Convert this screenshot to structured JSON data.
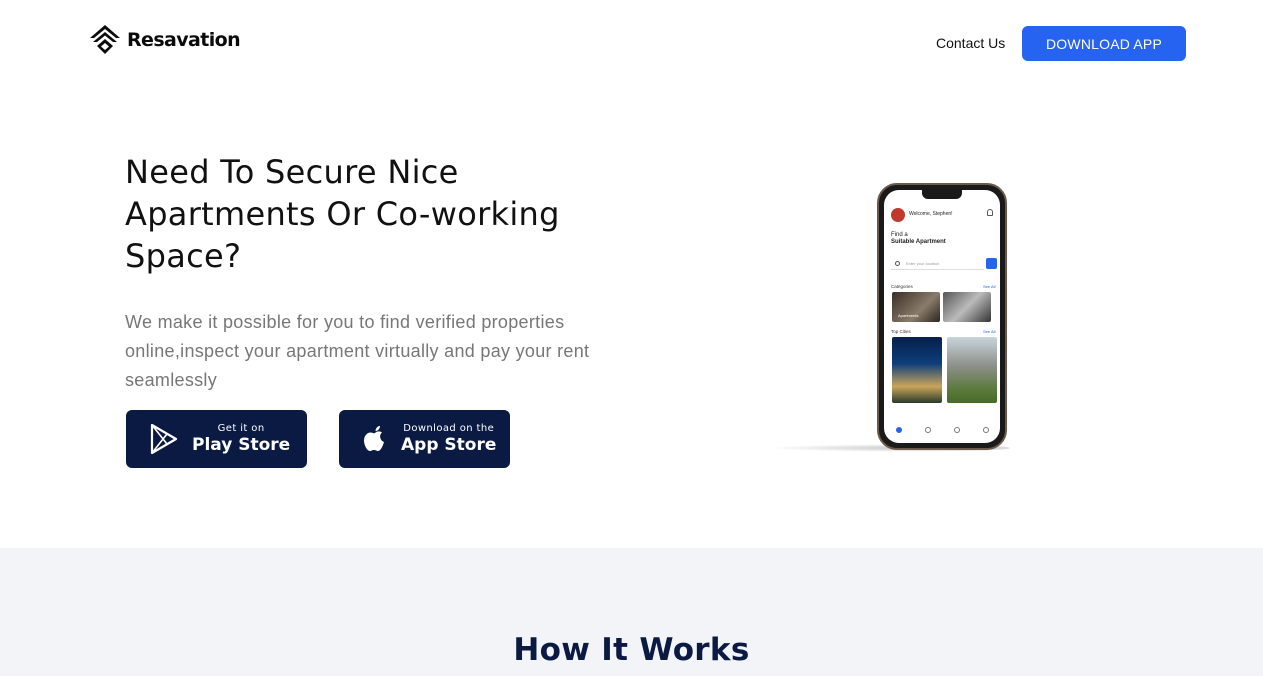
{
  "header": {
    "brand": "Resavation",
    "contact_label": "Contact Us",
    "download_label": "DOWNLOAD APP"
  },
  "hero": {
    "title": "Need To Secure Nice Apartments Or Co-working Space?",
    "subtitle": "We make it possible for you to find verified properties online,inspect your apartment virtually and pay your rent seamlessly",
    "play_store": {
      "small": "Get it on",
      "big": "Play Store"
    },
    "app_store": {
      "small": "Download on the",
      "big": "App Store"
    }
  },
  "phone": {
    "welcome": "Welcome, Stephen!",
    "find": "Find a",
    "find_bold": "Suitable Apartment",
    "search_placeholder": "Enter your location",
    "categories_label": "Categories",
    "see_all": "See All",
    "category_1": "Apartments",
    "top_cities_label": "Top Cities"
  },
  "how_it_works": {
    "title": "How It Works"
  },
  "colors": {
    "accent": "#2563f0",
    "navy": "#0a1a42",
    "section_bg": "#f3f4f8"
  }
}
